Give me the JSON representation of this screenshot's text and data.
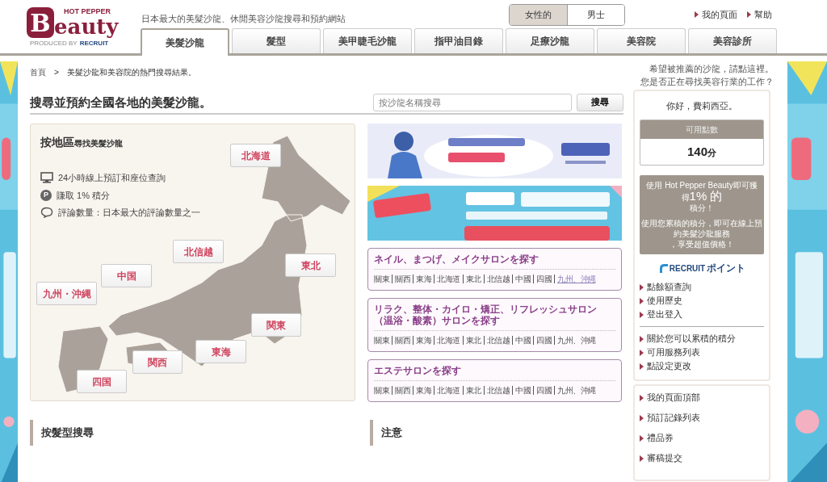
{
  "header": {
    "logo": {
      "brand_top": "HOT PEPPER",
      "initial": "B",
      "brand_rest": "eauty",
      "produced_by": "PRODUCED BY",
      "company": "RECRUIT"
    },
    "tagline": "日本最大的美髮沙龍、休閒美容沙龍搜尋和預約網站",
    "gender_toggle": [
      {
        "label": "女性的",
        "selected": true
      },
      {
        "label": "男士",
        "selected": false
      }
    ],
    "links": [
      "我的頁面",
      "幫助"
    ]
  },
  "tabs": [
    {
      "label": "美髮沙龍",
      "selected": true
    },
    {
      "label": "髮型",
      "selected": false
    },
    {
      "label": "美甲睫毛沙龍",
      "selected": false
    },
    {
      "label": "指甲油目錄",
      "selected": false
    },
    {
      "label": "足療沙龍",
      "selected": false
    },
    {
      "label": "美容院",
      "selected": false
    },
    {
      "label": "美容診所",
      "selected": false
    }
  ],
  "breadcrumb": {
    "items": [
      "首頁",
      "美髮沙龍和美容院的熱門搜尋結果。"
    ],
    "separator": ">"
  },
  "notices": [
    "希望被推薦的沙龍，請點這裡。",
    "您是否正在尋找美容行業的工作？"
  ],
  "heading": "搜尋並預約全國各地的美髮沙龍。",
  "search": {
    "placeholder": "按沙龍名稱搜尋",
    "button": "搜尋"
  },
  "map_card": {
    "title": "按地區",
    "subtitle": "尋找美髮沙龍",
    "features": [
      {
        "kind": "monitor",
        "text": "24小時線上預訂和座位查詢"
      },
      {
        "kind": "points",
        "icon_text": "P",
        "text": "賺取 1% 積分"
      },
      {
        "kind": "comment",
        "text": "評論數量：日本最大的評論數量之一"
      }
    ],
    "regions": [
      "北海道",
      "中国",
      "九州・沖縄",
      "北信越",
      "東北",
      "関東",
      "東海",
      "関西",
      "四国"
    ]
  },
  "salon_boxes": [
    {
      "title": "ネイル、まつげ、メイクサロンを探す",
      "regions": [
        {
          "label": "關東",
          "visited": false
        },
        {
          "label": "關西",
          "visited": false
        },
        {
          "label": "東海",
          "visited": false
        },
        {
          "label": "北海道",
          "visited": false
        },
        {
          "label": "東北",
          "visited": false
        },
        {
          "label": "北信越",
          "visited": false
        },
        {
          "label": "中國",
          "visited": false
        },
        {
          "label": "四國",
          "visited": false
        },
        {
          "label": "九州、沖縄",
          "visited": true
        }
      ]
    },
    {
      "title": "リラク、整体・カイロ・矯正、リフレッシュサロン（温浴・酸素）サロンを探す",
      "regions": [
        {
          "label": "關東",
          "visited": false
        },
        {
          "label": "關西",
          "visited": false
        },
        {
          "label": "東海",
          "visited": false
        },
        {
          "label": "北海道",
          "visited": false
        },
        {
          "label": "東北",
          "visited": false
        },
        {
          "label": "北信越",
          "visited": false
        },
        {
          "label": "中國",
          "visited": false
        },
        {
          "label": "四國",
          "visited": false
        },
        {
          "label": "九州、沖縄",
          "visited": false
        }
      ]
    },
    {
      "title": "エステサロンを探す",
      "regions": [
        {
          "label": "關東",
          "visited": false
        },
        {
          "label": "關西",
          "visited": false
        },
        {
          "label": "東海",
          "visited": false
        },
        {
          "label": "北海道",
          "visited": false
        },
        {
          "label": "東北",
          "visited": false
        },
        {
          "label": "北信越",
          "visited": false
        },
        {
          "label": "中國",
          "visited": false
        },
        {
          "label": "四國",
          "visited": false
        },
        {
          "label": "九州、沖縄",
          "visited": false
        }
      ]
    }
  ],
  "sections": [
    "按髮型搜尋",
    "注意"
  ],
  "sidebar": {
    "greeting": "你好，費莉西亞。",
    "points": {
      "label": "可用點數",
      "value": "140",
      "unit": "分"
    },
    "promo": {
      "intro": "使用 Hot Pepper Beauty即可獲",
      "small": "得",
      "highlight": "1% 的",
      "outro": "積分！",
      "note": "使用您累積的積分，即可在線上預約美髮沙龍服務",
      "note_end": "，享受超值價格！"
    },
    "point_logo": {
      "company": "RECRUIT",
      "suffix": "ポイント"
    },
    "point_links": [
      "點餘額查詢",
      "使用歷史",
      "登出登入"
    ],
    "info_links": [
      "關於您可以累積的積分",
      "可用服務列表",
      "點設定更改"
    ],
    "account_links": [
      "我的頁面頂部",
      "預訂記錄列表",
      "禮品券",
      "審稿提交"
    ]
  }
}
